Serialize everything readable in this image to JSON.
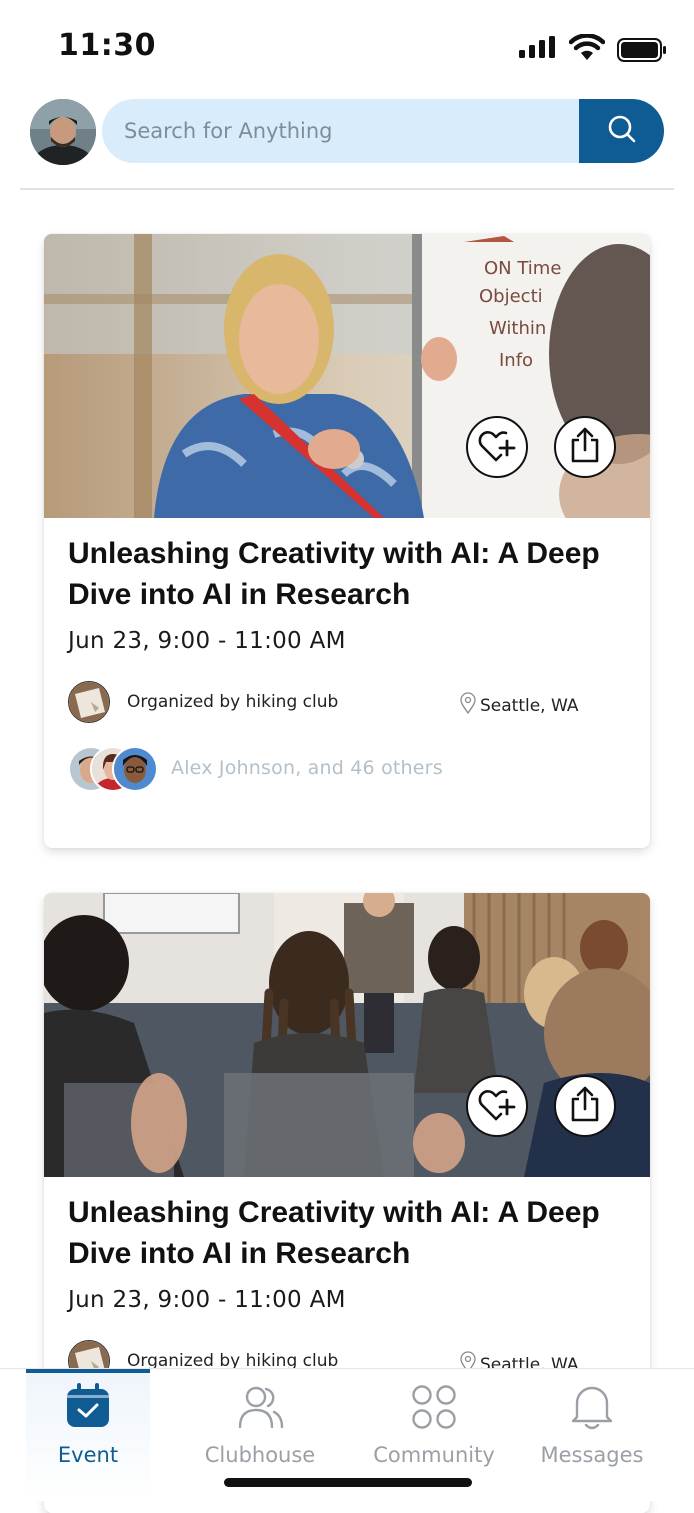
{
  "status_bar": {
    "time": "11:30"
  },
  "search": {
    "placeholder": "Search for Anything"
  },
  "events": [
    {
      "title": "Unleashing Creativity with AI: A Deep Dive into AI in Research",
      "date": "Jun 23, 9:00 - 11:00 AM",
      "organizer": "Organized by hiking club",
      "location": "Seattle, WA",
      "attendees": "Alex Johnson, and 46 others"
    },
    {
      "title": "Unleashing Creativity with AI: A Deep Dive into AI in Research",
      "date": "Jun 23, 9:00 - 11:00 AM",
      "organizer": "Organized by hiking club",
      "location": "Seattle, WA"
    }
  ],
  "tabs": [
    {
      "label": "Event",
      "icon": "calendar-icon",
      "active": true
    },
    {
      "label": "Clubhouse",
      "icon": "people-icon",
      "active": false
    },
    {
      "label": "Community",
      "icon": "grid-icon",
      "active": false
    },
    {
      "label": "Messages",
      "icon": "bell-icon",
      "active": false
    }
  ],
  "colors": {
    "accent": "#0f5b94",
    "search_bg": "#d9ecfb",
    "muted": "#9aa0a6"
  }
}
